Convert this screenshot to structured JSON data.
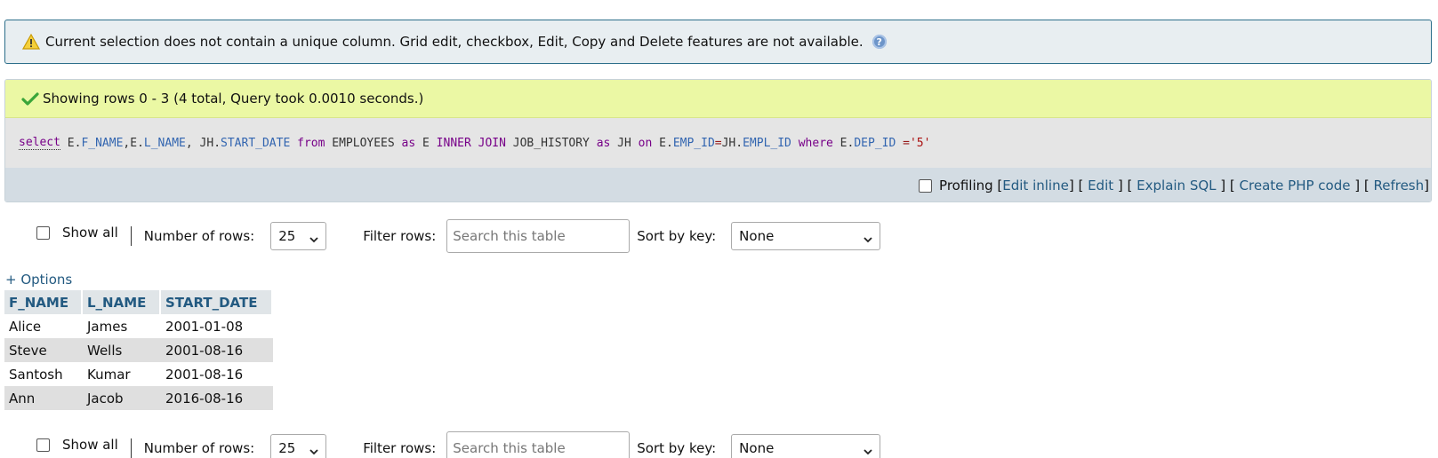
{
  "notice": {
    "text": "Current selection does not contain a unique column. Grid edit, checkbox, Edit, Copy and Delete features are not available.",
    "help_icon": "?"
  },
  "success": {
    "text": "Showing rows 0 - 3 (4 total, Query took 0.0010 seconds.)"
  },
  "sql": {
    "tokens": [
      {
        "t": "select",
        "c": "sel"
      },
      {
        "t": " ",
        "c": "plain"
      },
      {
        "t": "E",
        "c": "plain"
      },
      {
        "t": ".",
        "c": "plain"
      },
      {
        "t": "F_NAME",
        "c": "var"
      },
      {
        "t": ",",
        "c": "plain"
      },
      {
        "t": "E",
        "c": "plain"
      },
      {
        "t": ".",
        "c": "plain"
      },
      {
        "t": "L_NAME",
        "c": "var"
      },
      {
        "t": ", ",
        "c": "plain"
      },
      {
        "t": "JH",
        "c": "plain"
      },
      {
        "t": ".",
        "c": "plain"
      },
      {
        "t": "START_DATE",
        "c": "var"
      },
      {
        "t": " ",
        "c": "plain"
      },
      {
        "t": "from",
        "c": "kw"
      },
      {
        "t": " EMPLOYEES ",
        "c": "plain"
      },
      {
        "t": "as",
        "c": "kw"
      },
      {
        "t": " E ",
        "c": "plain"
      },
      {
        "t": "INNER JOIN",
        "c": "kw"
      },
      {
        "t": " JOB_HISTORY ",
        "c": "plain"
      },
      {
        "t": "as",
        "c": "kw"
      },
      {
        "t": " JH ",
        "c": "plain"
      },
      {
        "t": "on",
        "c": "kw"
      },
      {
        "t": " E.",
        "c": "plain"
      },
      {
        "t": "EMP_ID",
        "c": "var"
      },
      {
        "t": "=",
        "c": "op"
      },
      {
        "t": "JH.",
        "c": "plain"
      },
      {
        "t": "EMPL_ID",
        "c": "var"
      },
      {
        "t": " ",
        "c": "plain"
      },
      {
        "t": "where",
        "c": "kw"
      },
      {
        "t": " E.",
        "c": "plain"
      },
      {
        "t": "DEP_ID",
        "c": "var"
      },
      {
        "t": " =",
        "c": "op"
      },
      {
        "t": "'5'",
        "c": "str"
      }
    ]
  },
  "toolbar": {
    "profiling_label": "Profiling",
    "edit_inline": "Edit inline",
    "edit": "Edit",
    "explain_sql": "Explain SQL",
    "create_php_code": "Create PHP code",
    "refresh": "Refresh"
  },
  "nav": {
    "show_all_label": "Show all",
    "rows_label": "Number of rows:",
    "rows_value": "25",
    "filter_label": "Filter rows:",
    "filter_placeholder": "Search this table",
    "sort_label": "Sort by key:",
    "sort_value": "None"
  },
  "options_link": "+ Options",
  "table": {
    "headers": [
      "F_NAME",
      "L_NAME",
      "START_DATE"
    ],
    "rows": [
      [
        "Alice",
        "James",
        "2001-01-08"
      ],
      [
        "Steve",
        "Wells",
        "2001-08-16"
      ],
      [
        "Santosh",
        "Kumar",
        "2001-08-16"
      ],
      [
        "Ann",
        "Jacob",
        "2016-08-16"
      ]
    ]
  },
  "colors": {
    "link": "#235a81",
    "notice_border": "#2c6e8a",
    "success_bg": "#ebf8a4",
    "sql_bg": "#e5e5e5",
    "toolbar_bg": "#d3dce3",
    "keyword": "#770088",
    "identifier": "#3265b0",
    "string": "#aa1111"
  }
}
